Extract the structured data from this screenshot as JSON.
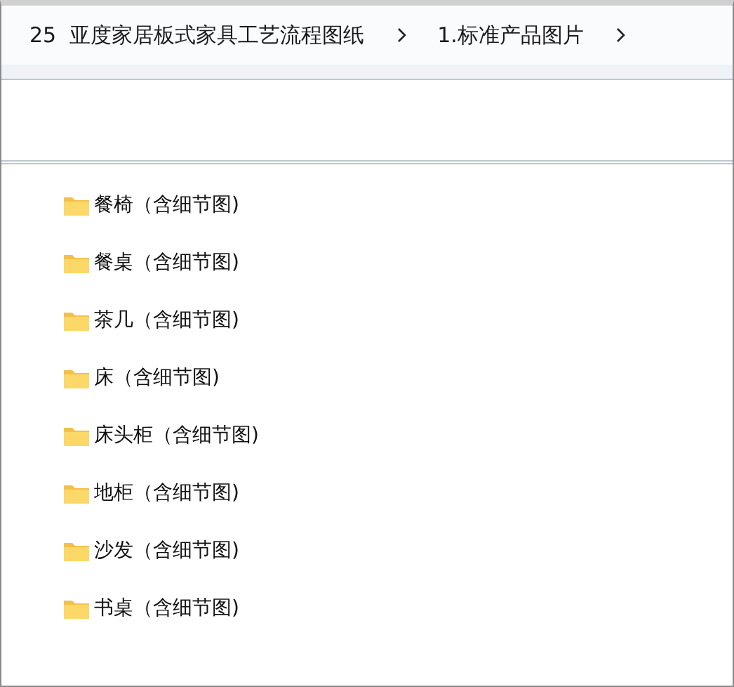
{
  "breadcrumb": [
    "25  亚度家居板式家具工艺流程图纸",
    "1.标准产品图片"
  ],
  "folders": [
    "餐椅（含细节图)",
    "餐桌（含细节图)",
    "茶几（含细节图)",
    "床（含细节图)",
    "床头柜（含细节图)",
    "地柜（含细节图)",
    "沙发（含细节图)",
    "书桌（含细节图)"
  ]
}
